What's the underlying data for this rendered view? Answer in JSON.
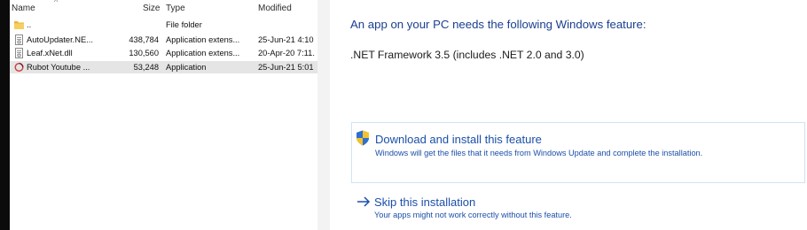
{
  "explorer": {
    "columns": {
      "name": "Name",
      "size": "Size",
      "type": "Type",
      "modified": "Modified"
    },
    "files": [
      {
        "icon": "folder-icon",
        "name": "..",
        "size": "",
        "type": "File folder",
        "modified": ""
      },
      {
        "icon": "dll-file-icon",
        "name": "AutoUpdater.NE...",
        "size": "438,784",
        "type": "Application extens...",
        "modified": "25-Jun-21 4:10"
      },
      {
        "icon": "dll-file-icon",
        "name": "Leaf.xNet.dll",
        "size": "130,560",
        "type": "Application extens...",
        "modified": "20-Apr-20 7:11."
      },
      {
        "icon": "app-icon",
        "name": "Rubot Youtube ...",
        "size": "53,248",
        "type": "Application",
        "modified": "25-Jun-21 5:01"
      }
    ]
  },
  "dialog": {
    "heading": "An app on your PC needs the following Windows feature:",
    "feature": ".NET Framework 3.5 (includes .NET 2.0 and 3.0)",
    "options": [
      {
        "icon": "uac-shield-icon",
        "title": "Download and install this feature",
        "description": "Windows will get the files that it needs from Windows Update and complete the installation."
      },
      {
        "icon": "arrow-right-icon",
        "title": "Skip this installation",
        "description": "Your apps might not work correctly without this feature."
      }
    ]
  },
  "colors": {
    "link_blue": "#1b4fa8",
    "heading_blue": "#1a3f8f",
    "box_border": "#cfe3f5",
    "selected_row": "#e5e5e5"
  }
}
